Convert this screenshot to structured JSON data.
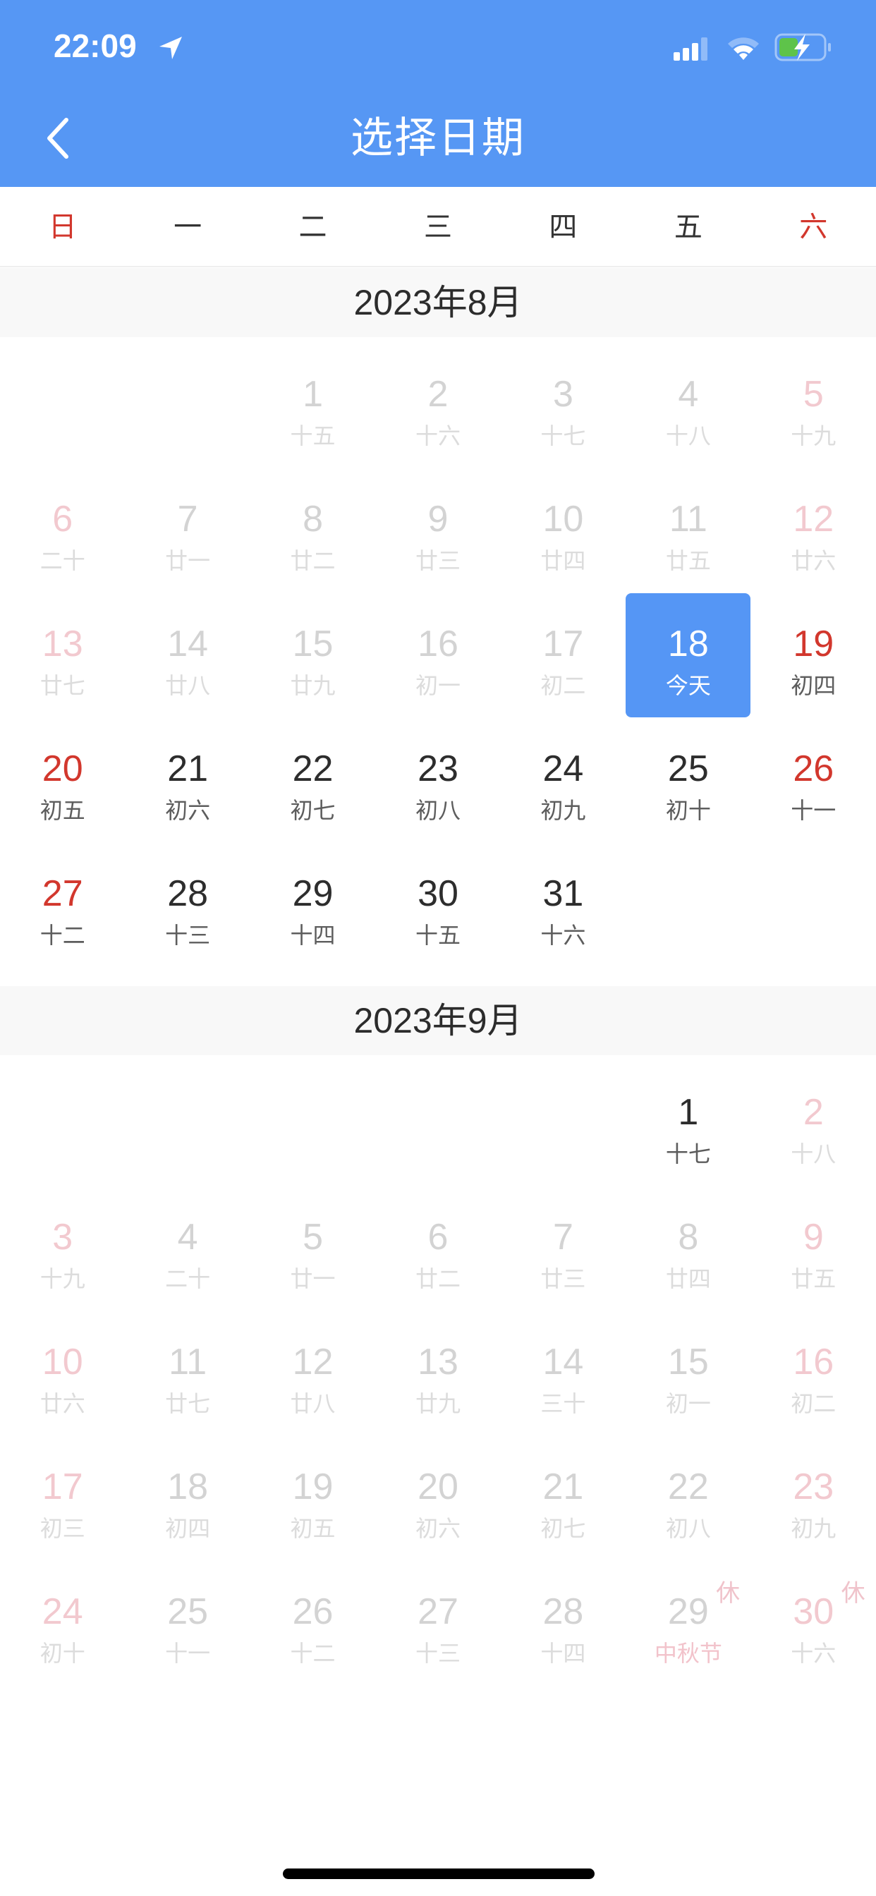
{
  "status_bar": {
    "time": "22:09",
    "icons": [
      "location-arrow-icon",
      "cellular-signal-icon",
      "wifi-icon",
      "battery-charging-icon"
    ]
  },
  "nav": {
    "back_icon": "chevron-left-icon",
    "title": "选择日期"
  },
  "colors": {
    "header_bg": "#5697f4",
    "selected_bg": "#5596f5",
    "weekend_red": "#d2372d",
    "past_gray": "#d3d3d3",
    "past_weekend_pink": "#f2c9cf",
    "text_dark": "#2d2d2d"
  },
  "weekdays": [
    {
      "label": "日",
      "weekend": true
    },
    {
      "label": "一",
      "weekend": false
    },
    {
      "label": "二",
      "weekend": false
    },
    {
      "label": "三",
      "weekend": false
    },
    {
      "label": "四",
      "weekend": false
    },
    {
      "label": "五",
      "weekend": false
    },
    {
      "label": "六",
      "weekend": true
    }
  ],
  "months": [
    {
      "title": "2023年8月",
      "first_weekday": 2,
      "days": [
        {
          "d": "1",
          "lunar": "十五",
          "state": "past"
        },
        {
          "d": "2",
          "lunar": "十六",
          "state": "past"
        },
        {
          "d": "3",
          "lunar": "十七",
          "state": "past"
        },
        {
          "d": "4",
          "lunar": "十八",
          "state": "past"
        },
        {
          "d": "5",
          "lunar": "十九",
          "state": "past"
        },
        {
          "d": "6",
          "lunar": "二十",
          "state": "past"
        },
        {
          "d": "7",
          "lunar": "廿一",
          "state": "past"
        },
        {
          "d": "8",
          "lunar": "廿二",
          "state": "past"
        },
        {
          "d": "9",
          "lunar": "廿三",
          "state": "past"
        },
        {
          "d": "10",
          "lunar": "廿四",
          "state": "past"
        },
        {
          "d": "11",
          "lunar": "廿五",
          "state": "past"
        },
        {
          "d": "12",
          "lunar": "廿六",
          "state": "past"
        },
        {
          "d": "13",
          "lunar": "廿七",
          "state": "past"
        },
        {
          "d": "14",
          "lunar": "廿八",
          "state": "past"
        },
        {
          "d": "15",
          "lunar": "廿九",
          "state": "past"
        },
        {
          "d": "16",
          "lunar": "初一",
          "state": "past"
        },
        {
          "d": "17",
          "lunar": "初二",
          "state": "past"
        },
        {
          "d": "18",
          "lunar": "今天",
          "state": "selected"
        },
        {
          "d": "19",
          "lunar": "初四",
          "state": "future"
        },
        {
          "d": "20",
          "lunar": "初五",
          "state": "future"
        },
        {
          "d": "21",
          "lunar": "初六",
          "state": "future"
        },
        {
          "d": "22",
          "lunar": "初七",
          "state": "future"
        },
        {
          "d": "23",
          "lunar": "初八",
          "state": "future"
        },
        {
          "d": "24",
          "lunar": "初九",
          "state": "future"
        },
        {
          "d": "25",
          "lunar": "初十",
          "state": "future"
        },
        {
          "d": "26",
          "lunar": "十一",
          "state": "future"
        },
        {
          "d": "27",
          "lunar": "十二",
          "state": "future"
        },
        {
          "d": "28",
          "lunar": "十三",
          "state": "future"
        },
        {
          "d": "29",
          "lunar": "十四",
          "state": "future"
        },
        {
          "d": "30",
          "lunar": "十五",
          "state": "future"
        },
        {
          "d": "31",
          "lunar": "十六",
          "state": "future"
        }
      ]
    },
    {
      "title": "2023年9月",
      "first_weekday": 5,
      "days": [
        {
          "d": "1",
          "lunar": "十七",
          "state": "future"
        },
        {
          "d": "2",
          "lunar": "十八",
          "state": "past"
        },
        {
          "d": "3",
          "lunar": "十九",
          "state": "past"
        },
        {
          "d": "4",
          "lunar": "二十",
          "state": "past"
        },
        {
          "d": "5",
          "lunar": "廿一",
          "state": "past"
        },
        {
          "d": "6",
          "lunar": "廿二",
          "state": "past"
        },
        {
          "d": "7",
          "lunar": "廿三",
          "state": "past"
        },
        {
          "d": "8",
          "lunar": "廿四",
          "state": "past"
        },
        {
          "d": "9",
          "lunar": "廿五",
          "state": "past"
        },
        {
          "d": "10",
          "lunar": "廿六",
          "state": "past"
        },
        {
          "d": "11",
          "lunar": "廿七",
          "state": "past"
        },
        {
          "d": "12",
          "lunar": "廿八",
          "state": "past"
        },
        {
          "d": "13",
          "lunar": "廿九",
          "state": "past"
        },
        {
          "d": "14",
          "lunar": "三十",
          "state": "past"
        },
        {
          "d": "15",
          "lunar": "初一",
          "state": "past"
        },
        {
          "d": "16",
          "lunar": "初二",
          "state": "past"
        },
        {
          "d": "17",
          "lunar": "初三",
          "state": "past"
        },
        {
          "d": "18",
          "lunar": "初四",
          "state": "past"
        },
        {
          "d": "19",
          "lunar": "初五",
          "state": "past"
        },
        {
          "d": "20",
          "lunar": "初六",
          "state": "past"
        },
        {
          "d": "21",
          "lunar": "初七",
          "state": "past"
        },
        {
          "d": "22",
          "lunar": "初八",
          "state": "past"
        },
        {
          "d": "23",
          "lunar": "初九",
          "state": "past"
        },
        {
          "d": "24",
          "lunar": "初十",
          "state": "past"
        },
        {
          "d": "25",
          "lunar": "十一",
          "state": "past"
        },
        {
          "d": "26",
          "lunar": "十二",
          "state": "past"
        },
        {
          "d": "27",
          "lunar": "十三",
          "state": "past"
        },
        {
          "d": "28",
          "lunar": "十四",
          "state": "past"
        },
        {
          "d": "29",
          "lunar": "中秋节",
          "state": "past",
          "holiday": true,
          "badge": "休"
        },
        {
          "d": "30",
          "lunar": "十六",
          "state": "past",
          "badge": "休"
        }
      ]
    }
  ]
}
